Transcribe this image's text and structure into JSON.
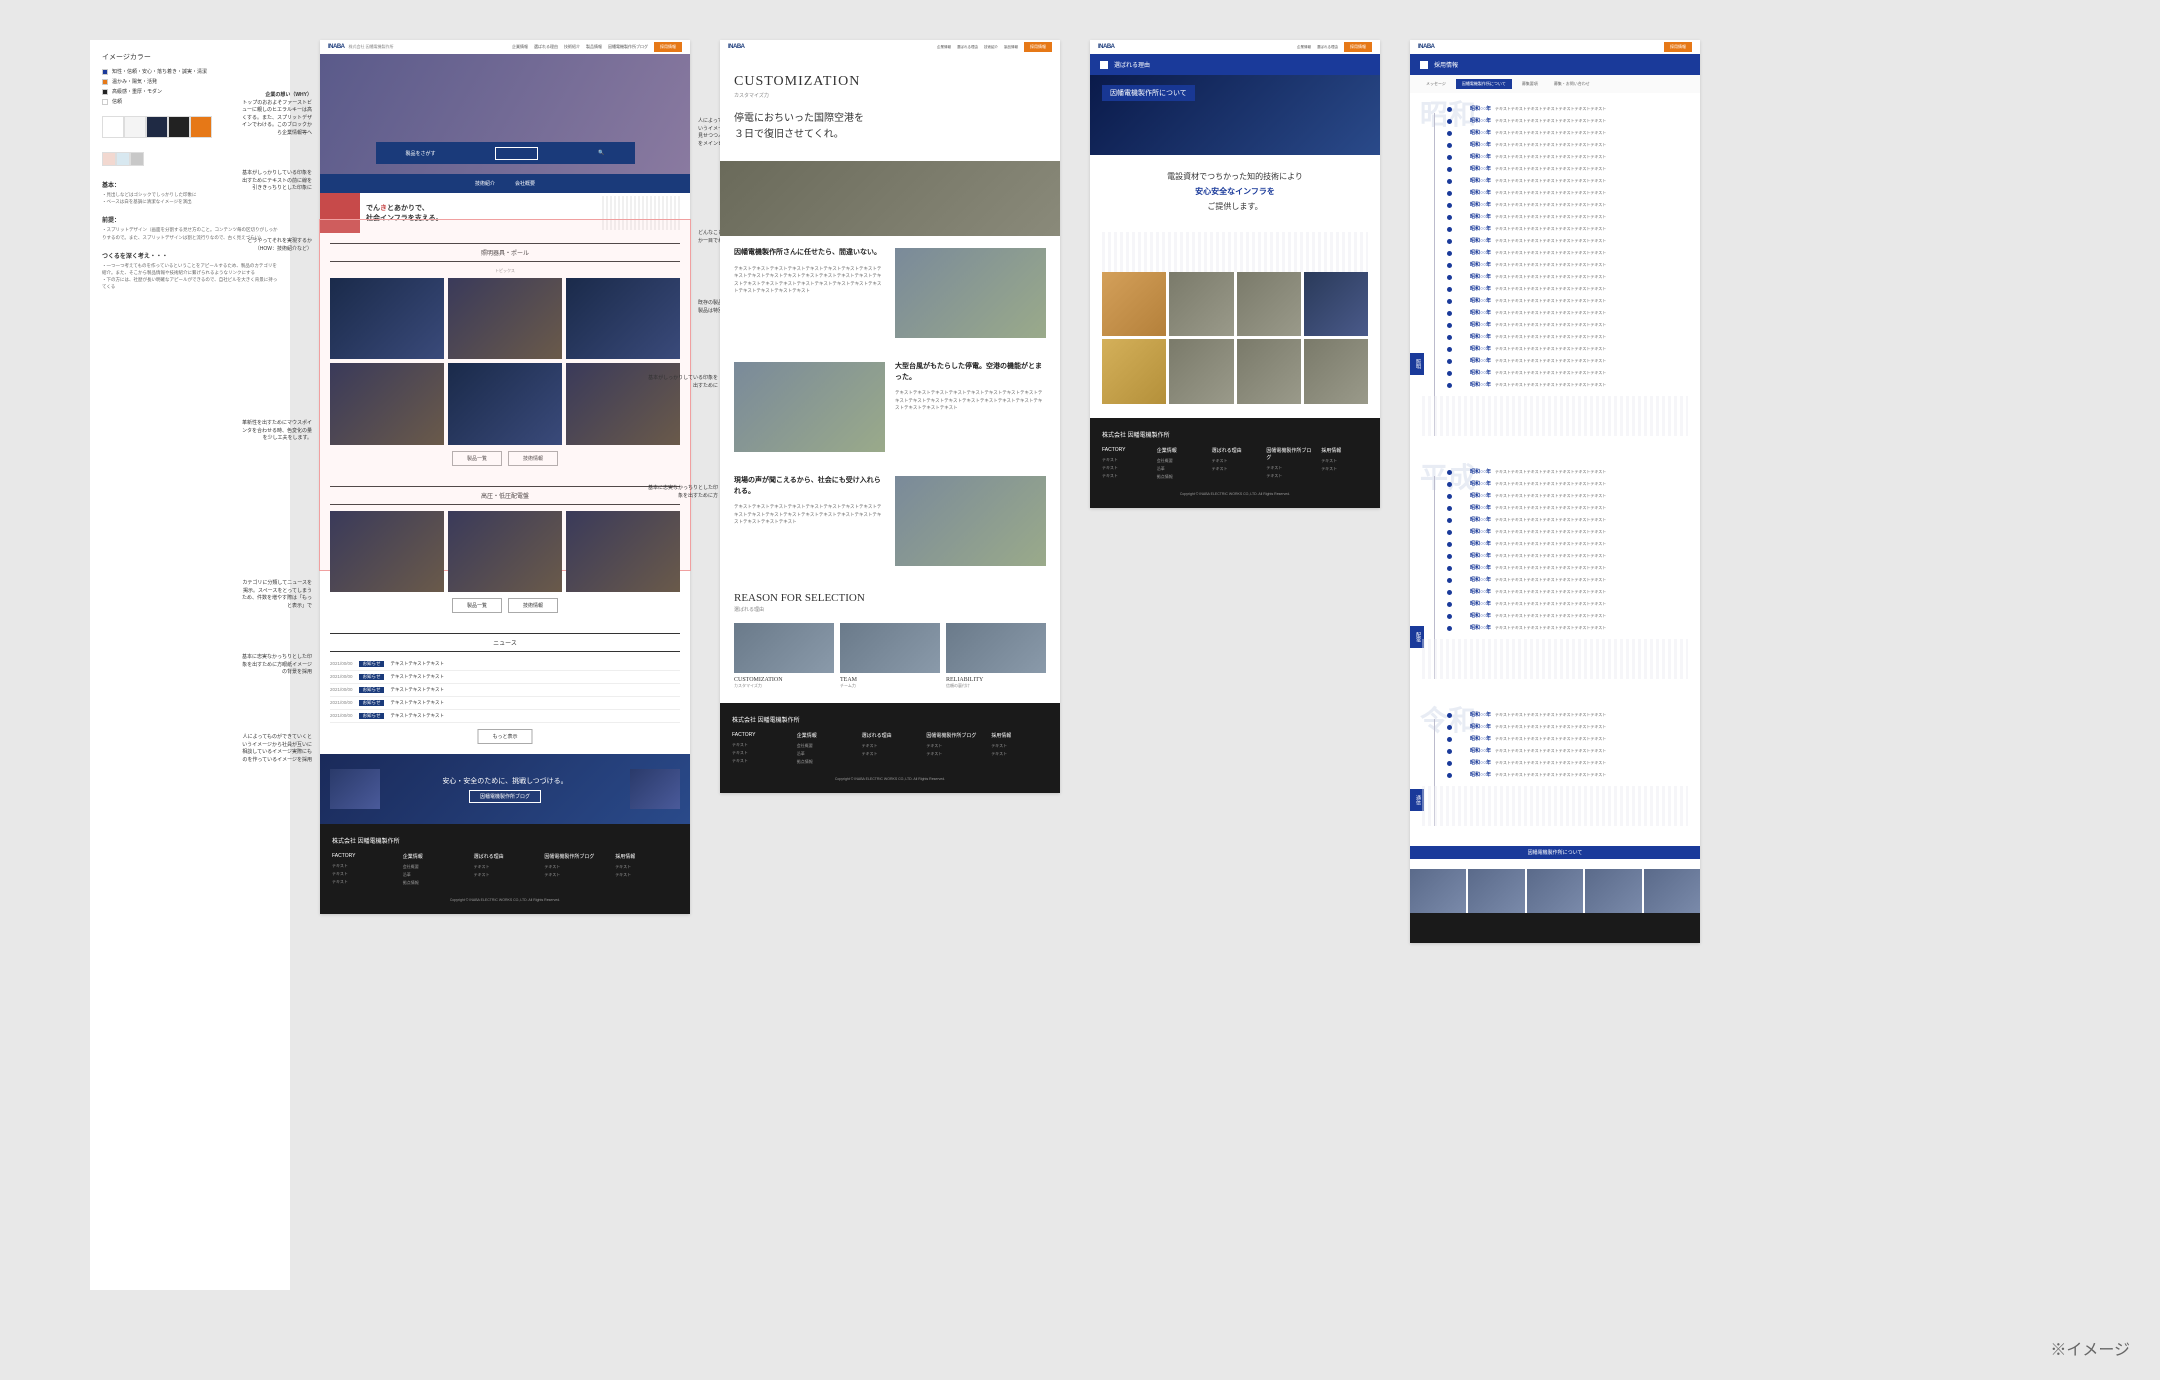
{
  "palette": {
    "title": "イメージカラー",
    "legends": [
      {
        "c": "#1a3a9a",
        "t": "知性・信頼・安心・落ち着き・誠実・清潔"
      },
      {
        "c": "#e67817",
        "t": "温かみ・陽気・活発"
      },
      {
        "c": "#222222",
        "t": "高級感・重厚・モダン"
      },
      {
        "c": "#ffffff",
        "t": "信頼"
      }
    ],
    "main_swatches": [
      "#ffffff",
      "#f4f4f4",
      "#1f2a44",
      "#222222",
      "#e67817"
    ],
    "sub_swatches": [
      "#f2d8d0",
      "#d8e8f0",
      "#c8c8c8"
    ]
  },
  "specs": [
    {
      "label": "基本：",
      "text": "・見出しなどはゴシックでしっかりした印象に\n・ベースは白を基調に清潔なイメージを演出"
    },
    {
      "label": "前提：",
      "text": "・スプリットデザイン（画面を分割する見せ方のこと。コンテンツ毎の区切りがしっかりするので。また、スプリットデザインは割と流行りなので、古く見えづらい）"
    },
    {
      "label": "つくるを深く考え・・・",
      "text": "・一つ一つ考えてものを作っているということをアピールするため、製品のカテゴリを紹介。また、そこから製品情報や技術紹介に繋げられるようなリンクにする\n・下の方には、社歴が長い明確なアピールができるので、自社ビルを大きく背景に持ってくる"
    }
  ],
  "annotations": {
    "a1": "企業の想い（WHY）",
    "a1b": "トップのおおよそファーストビューに親しのヒエラルキーは高くする。また、スプリットデザインでわける。このブロックから企業情報等へ",
    "a2": "基本がしっかりしている印象を出すためにテキストの前に線を引ききっちりとした印象に",
    "a3": "どうやってそれを実現するか（HOW：技術紹介など）",
    "a4": "人によってものができていくというイメージから製品を大きく見せつつ人の気配を感じる写真をメインビジュアルに使用",
    "a5": "どんなことに力を入れているのか一目でわかるように",
    "a6": "革新性を出すためにマウスポインタを合わせる時、色変化の量を少し工夫をします。",
    "a7": "既存の製品カテゴリと新規開発製品は特別枠で掲示",
    "a8": "基本がしっかりしている印象を出すために",
    "a9": "基本に忠実なかっちりとした印象を出すために方",
    "a10": "カテゴリに分類してニュースを掲示。スペースをとってしまうため、件数を増やす際は「もっと表示」で",
    "a11": "基本に忠実なかっちりとした印象を出すために方眼紙イメージの背景を採用",
    "a12": "人によってものができていくというイメージから社員が互いに相談しているイメージ実際にものを作っているイメージを採用"
  },
  "header": {
    "logo": "INABA",
    "company": "株式会社 因幡電機製作所",
    "nav": [
      "企業情報",
      "選ばれる理由",
      "技術紹介",
      "製品情報",
      "因幡電機製作所ブログ"
    ],
    "cta": "採用情報"
  },
  "hero": {
    "search_label": "製品をさがす",
    "btn1": "技術紹介",
    "btn2": "会社概要"
  },
  "banner1": {
    "pre": "でん",
    "mid": "き",
    "post": "とあかりで、",
    "line2": "社会インフラを支える。"
  },
  "products": {
    "title1": "照明器具・ポール",
    "tab": "トピックス",
    "btn_list": "製品一覧",
    "btn_tech": "技術情報",
    "title2": "高圧・低圧配電盤"
  },
  "news": {
    "title": "ニュース",
    "items": [
      {
        "date": "2021/00/00",
        "cat": "お知らせ",
        "text": "テキストテキストテキスト"
      },
      {
        "date": "2021/00/00",
        "cat": "お知らせ",
        "text": "テキストテキストテキスト"
      },
      {
        "date": "2021/00/00",
        "cat": "お知らせ",
        "text": "テキストテキストテキスト"
      },
      {
        "date": "2021/00/00",
        "cat": "お知らせ",
        "text": "テキストテキストテキスト"
      },
      {
        "date": "2021/00/00",
        "cat": "お知らせ",
        "text": "テキストテキストテキスト"
      }
    ],
    "more": "もっと表示"
  },
  "blue_banner": "安心・安全のために、挑戦しつづける。",
  "blue_banner_btn": "因幡電機製作所ブログ",
  "footer": {
    "company": "株式会社 因幡電機製作所",
    "cols": [
      {
        "title": "FACTORY",
        "links": [
          "テキスト",
          "テキスト",
          "テキスト"
        ]
      },
      {
        "title": "企業情報",
        "links": [
          "会社概要",
          "沿革",
          "拠点情報"
        ]
      },
      {
        "title": "選ばれる理由",
        "links": [
          "テキスト",
          "テキスト"
        ]
      },
      {
        "title": "因幡電機製作所ブログ",
        "links": [
          "テキスト",
          "テキスト"
        ]
      },
      {
        "title": "採用情報",
        "links": [
          "テキスト",
          "テキスト"
        ]
      }
    ],
    "copyright": "Copyright © INABA ELECTRIC WORKS CO.,LTD. All Rights Reserved."
  },
  "customization": {
    "title": "CUSTOMIZATION",
    "subtitle": "カスタマイズ力",
    "headline1": "停電におちいった国際空港を",
    "headline2": "３日で復旧させてくれ。",
    "story1_head": "因幡電機製作所さんに任せたら、間違いない。",
    "story1_body": "テキストテキストテキストテキストテキストテキストテキストテキストテキストテキストテキストテキストテキストテキストテキストテキストテキストテキストテキストテキストテキストテキストテキストテキストテキストテキストテキストテキストテキスト",
    "story2_head": "大型台風がもたらした停電。空港の機能がとまった。",
    "story2_body": "テキストテキストテキストテキストテキストテキストテキストテキストテキストテキストテキストテキストテキストテキストテキストテキストテキストテキストテキストテキスト",
    "story3_head": "現場の声が聞こえるから、社会にも受け入れられる。",
    "story3_body": "テキストテキストテキストテキストテキストテキストテキストテキストテキストテキストテキストテキストテキストテキストテキストテキストテキストテキストテキストテキスト",
    "reason_title": "REASON FOR SELECTION",
    "reason_sub": "選ばれる理由",
    "reasons": [
      {
        "en": "CUSTOMIZATION",
        "jp": "カスタマイズ力"
      },
      {
        "en": "TEAM",
        "jp": "チーム力"
      },
      {
        "en": "RELIABILITY",
        "jp": "信頼の裏付け"
      }
    ]
  },
  "about": {
    "crumb": "選ばれる理由",
    "hero_title": "因幡電機製作所について",
    "intro1": "電設資材でつちかった知的技術により",
    "intro2": "安心安全なインフラを",
    "intro3": "ご提供します。"
  },
  "recruit": {
    "crumb": "採用情報",
    "tabs": [
      "メッセージ",
      "因幡電機製作所について",
      "募集要項",
      "募集・お問い合わせ"
    ],
    "eras": [
      "昭和",
      "平成",
      "令和"
    ],
    "era_tabs": [
      "照明",
      "配電",
      "通信"
    ],
    "timeline_sample_year": "昭和○○年",
    "timeline_sample_text": "テキストテキストテキストテキストテキストテキストテキスト",
    "cta_head": "因幡電機製作所について"
  },
  "caption": "※イメージ"
}
